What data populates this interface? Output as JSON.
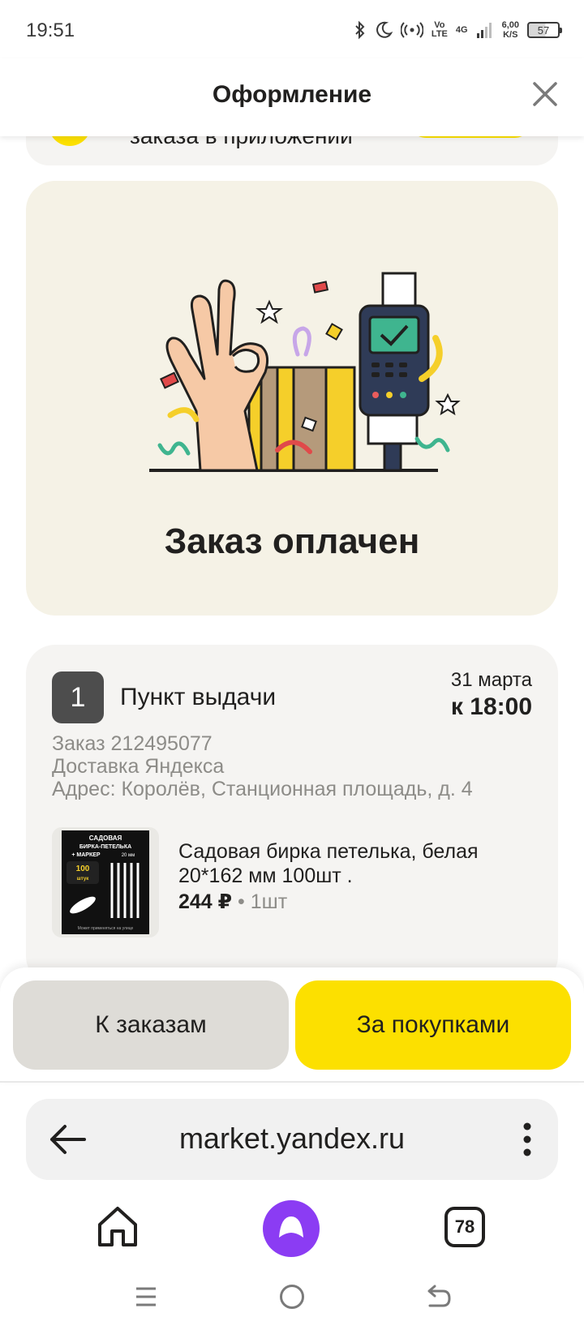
{
  "status_bar": {
    "time": "19:51",
    "network_top": "Vo",
    "network_bottom": "LTE",
    "signal_label": "4G",
    "speed_top": "6,00",
    "speed_bottom": "K/S",
    "battery_percent": "57"
  },
  "header": {
    "title": "Оформление",
    "close_icon": "close-icon"
  },
  "banner": {
    "text": "заказа в приложении"
  },
  "success": {
    "title": "Заказ оплачен"
  },
  "order": {
    "number": "1",
    "pickup_label": "Пункт выдачи",
    "date": "31 марта",
    "time": "к 18:00",
    "order_line": "Заказ 212495077",
    "delivery_line": "Доставка Яндекса",
    "address_line": "Адрес: Королёв, Станционная площадь, д. 4",
    "product": {
      "name": "Садовая бирка петелька, белая 20*162 мм 100шт .",
      "price": "244 ₽",
      "qty": "1шт",
      "thumb_title": "САДОВАЯ БИРКА-ПЕТЕЛЬКА + МАРКЕР",
      "thumb_count": "100",
      "thumb_unit": "штук",
      "thumb_size": "20 мм",
      "thumb_footer": "Может применяться на улице"
    }
  },
  "actions": {
    "orders_label": "К заказам",
    "shop_label": "За покупками"
  },
  "browser": {
    "url": "market.yandex.ru",
    "tabs_count": "78"
  },
  "colors": {
    "accent_yellow": "#fce000",
    "success_bg": "#f5f2e6",
    "card_bg": "#f5f4f2",
    "alice_purple": "#8b3cf3"
  }
}
